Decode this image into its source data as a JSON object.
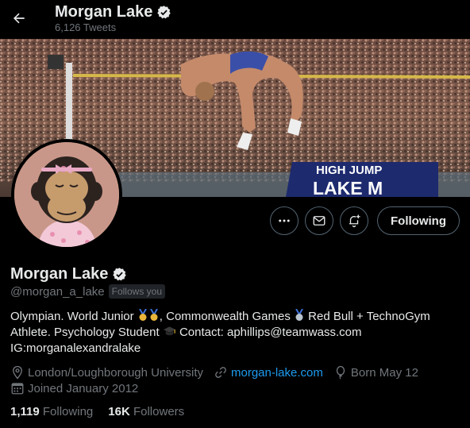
{
  "header": {
    "name": "Morgan Lake",
    "tweets_count": "6,126 Tweets"
  },
  "banner": {
    "sign_line1": "HIGH JUMP",
    "sign_line2": "LAKE M"
  },
  "actions": {
    "more_icon": "more-icon",
    "message_icon": "mail-icon",
    "notify_icon": "bell-plus-icon",
    "following_label": "Following"
  },
  "profile": {
    "name": "Morgan Lake",
    "handle": "@morgan_a_lake",
    "follows_you": "Follows you",
    "bio_part1": "Olympian. World Junior ",
    "bio_part2": ", Commonwealth Games ",
    "bio_part3": " Red Bull + TechnoGym",
    "bio_line2a": "Athlete. Psychology Student ",
    "bio_line2b": " Contact: aphillips@teamwass.com",
    "bio_line3": "IG:morganalexandralake",
    "location": "London/Loughborough University",
    "website": "morgan-lake.com",
    "birthday": "Born May 12",
    "joined": "Joined January 2012"
  },
  "stats": {
    "following_count": "1,119",
    "following_label": "Following",
    "followers_count": "16K",
    "followers_label": "Followers"
  },
  "colors": {
    "background": "#000000",
    "text": "#e7e9ea",
    "muted": "#71767b",
    "link": "#1d9bf0",
    "verified": "#e7e9ea"
  }
}
